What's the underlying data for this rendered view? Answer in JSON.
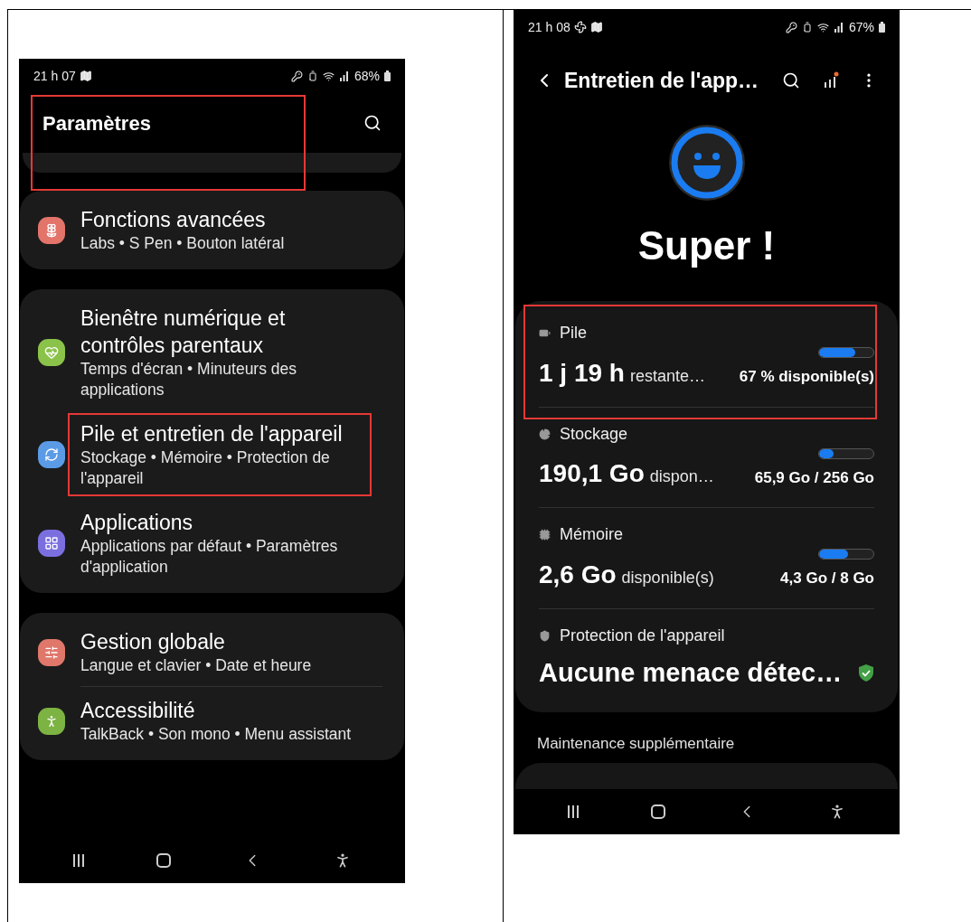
{
  "left_phone": {
    "status_bar": {
      "time": "21 h 07",
      "battery": "68%"
    },
    "title": {
      "text": "Paramètres",
      "highlighted": true
    },
    "groups": [
      {
        "items": [
          {
            "title": "Fonctions avancées",
            "subtitle": "Labs • S Pen • Bouton latéral",
            "color": "#e2746a",
            "highlighted": false
          }
        ]
      },
      {
        "items": [
          {
            "title": "Bienêtre numérique et contrôles parentaux",
            "subtitle": "Temps d'écran • Minuteurs des applications",
            "color": "#8bc34a",
            "highlighted": false
          },
          {
            "title": "Pile et entretien de l'appareil",
            "subtitle": "Stockage • Mémoire • Protection de l'appareil",
            "color": "#5b9be6",
            "highlighted": true
          },
          {
            "title": "Applications",
            "subtitle": "Applications par défaut • Paramètres d'application",
            "color": "#7b6fe0",
            "highlighted": false
          }
        ]
      },
      {
        "items": [
          {
            "title": "Gestion globale",
            "subtitle": "Langue et clavier • Date et heure",
            "color": "#e0776b",
            "highlighted": false
          },
          {
            "title": "Accessibilité",
            "subtitle": "TalkBack • Son mono • Menu assistant",
            "color": "#7cb342",
            "highlighted": false
          }
        ]
      }
    ]
  },
  "right_phone": {
    "status_bar": {
      "time": "21 h 08",
      "battery": "67%"
    },
    "header": {
      "title": "Entretien de l'app…"
    },
    "status": "Super !",
    "rows": [
      {
        "kind": "meter",
        "label": "Pile",
        "value": "1 j 19 h",
        "unit": "restante…",
        "reading": "67 % disponible(s)",
        "level": 0.67,
        "highlighted": true
      },
      {
        "kind": "meter",
        "label": "Stockage",
        "value": "190,1 Go",
        "unit": "dispon…",
        "reading": "65,9 Go / 256 Go",
        "level": 0.26,
        "highlighted": false
      },
      {
        "kind": "meter",
        "label": "Mémoire",
        "value": "2,6 Go",
        "unit": "disponible(s)",
        "reading": "4,3 Go / 8 Go",
        "level": 0.54,
        "highlighted": false
      },
      {
        "kind": "status",
        "label": "Protection de l'appareil",
        "value": "Aucune menace détec…",
        "highlighted": false
      }
    ],
    "section_header": "Maintenance supplémentaire"
  }
}
